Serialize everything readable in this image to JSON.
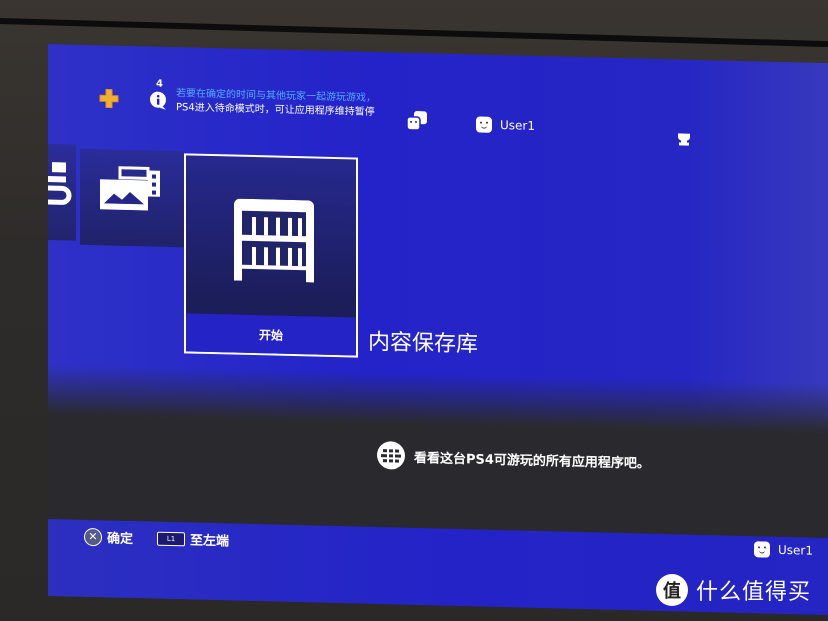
{
  "topbar": {
    "notification_count": "4",
    "notification_line1": "若要在确定的时间与其他玩家一起游玩游戏，",
    "notification_line2": "PS4进入待命模式时，可让应用程序维持暂停",
    "user_name": "User1"
  },
  "content": {
    "selected_tile": {
      "action_label": "开始",
      "title": "内容保存库",
      "icon": "library-shelf-icon"
    },
    "other_tiles": [
      {
        "icon": "tv-video-icon"
      },
      {
        "icon": "capture-gallery-icon"
      }
    ],
    "hint_text": "看看这台PS4可游玩的所有应用程序吧。",
    "hint_icon": "globe-icon"
  },
  "footer": {
    "actions": [
      {
        "button": "✕",
        "label": "确定"
      },
      {
        "button": "L1",
        "label": "至左端"
      }
    ],
    "user_name": "User1"
  },
  "watermark": {
    "logo_char": "值",
    "text": "什么值得买"
  },
  "colors": {
    "ps_blue": "#2323c8",
    "notification_blue": "#55aaff",
    "plus_yellow": "#f0b030"
  }
}
